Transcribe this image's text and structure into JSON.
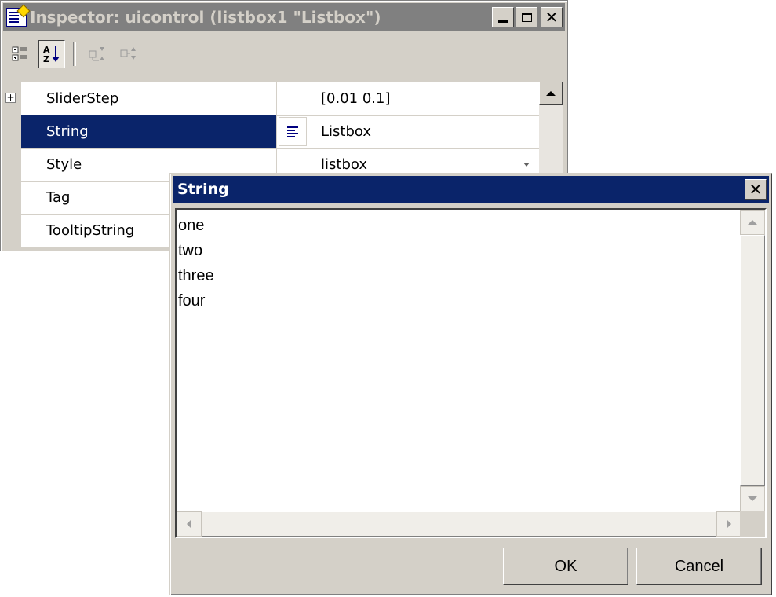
{
  "inspector": {
    "title": "Inspector:  uicontrol (listbox1 \"Listbox\")",
    "window_buttons": {
      "minimize": "_",
      "maximize": "□",
      "close": "✕"
    },
    "toolbar": {
      "categorized": "⊞",
      "alphabetical": "A↓Z",
      "expand": "⇣",
      "collapse": "⇡"
    },
    "properties": [
      {
        "name": "SliderStep",
        "value": "[0.01 0.1]",
        "expandable": true
      },
      {
        "name": "String",
        "value": "Listbox",
        "selected": true
      },
      {
        "name": "Style",
        "value": "listbox"
      },
      {
        "name": "Tag",
        "value": ""
      },
      {
        "name": "TooltipString",
        "value": ""
      }
    ]
  },
  "string_dialog": {
    "title": "String",
    "close": "✕",
    "lines": [
      "one",
      "two",
      "three",
      "four"
    ],
    "ok_label": "OK",
    "cancel_label": "Cancel"
  },
  "colors": {
    "title_active": "#0a246a",
    "title_inactive": "#808080",
    "face": "#d4d0c8",
    "selection": "#0a246a"
  }
}
